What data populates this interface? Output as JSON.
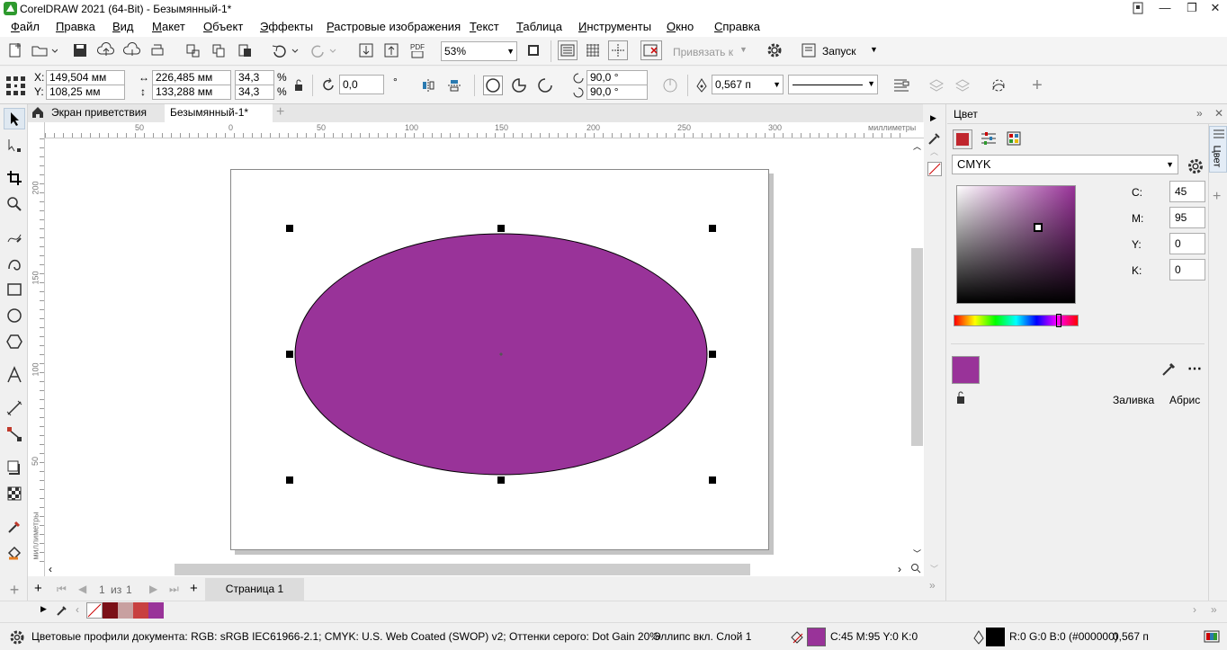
{
  "window": {
    "title": "CorelDRAW 2021 (64-Bit) - Безымянный-1*",
    "buttons": [
      "minimize",
      "restore",
      "close"
    ]
  },
  "menu": [
    "Файл",
    "Правка",
    "Вид",
    "Макет",
    "Объект",
    "Эффекты",
    "Растровые изображения",
    "Текст",
    "Таблица",
    "Инструменты",
    "Окно",
    "Справка"
  ],
  "standard_toolbar": {
    "zoom": "53%",
    "snap_to": "Привязать к",
    "launch": "Запуск",
    "pdf_label": "PDF"
  },
  "property_bar": {
    "x_label": "X:",
    "y_label": "Y:",
    "x": "149,504 мм",
    "y": "108,25 мм",
    "width": "226,485 мм",
    "height": "133,288 мм",
    "scale_w": "34,3",
    "scale_h": "34,3",
    "percent": "%",
    "rotation": "0,0",
    "degree_mark": "°",
    "angle_start": "90,0 °",
    "angle_end": "90,0 °",
    "outline_width": "0,567 п"
  },
  "tabs": [
    {
      "label": "Экран приветствия"
    },
    {
      "label": "Безымянный-1*"
    }
  ],
  "rulers": {
    "units": "миллиметры",
    "h_ticks": [
      "50",
      "0",
      "50",
      "100",
      "150",
      "200",
      "250",
      "300"
    ],
    "v_ticks": [
      "200",
      "150",
      "100",
      "50"
    ]
  },
  "shape": {
    "type": "ellipse",
    "fill": "#993399",
    "outline": "#000000"
  },
  "pages": {
    "current": "1",
    "of": "из",
    "total": "1",
    "tab": "Страница 1"
  },
  "palette": [
    "#7b1017",
    "#c8a0a0",
    "#c84040",
    "#993399"
  ],
  "status": {
    "profiles": "Цветовые профили документа: RGB: sRGB IEC61966-2.1; CMYK: U.S. Web Coated (SWOP) v2; Оттенки серого: Dot Gain 20%",
    "object": "Эллипс вкл. Слой 1",
    "fill_value": "C:45 M:95 Y:0 K:0",
    "fill_color": "#993399",
    "outline_value": "R:0 G:0 B:0 (#000000)",
    "outline_width": "0,567 п"
  },
  "color_docker": {
    "title": "Цвет",
    "model": "CMYK",
    "c_label": "C:",
    "m_label": "M:",
    "y_label": "Y:",
    "k_label": "K:",
    "c": "45",
    "m": "95",
    "y": "0",
    "k": "0",
    "swatch": "#993399",
    "fill_label": "Заливка",
    "outline_label": "Абрис",
    "side_tab": "Цвет"
  }
}
